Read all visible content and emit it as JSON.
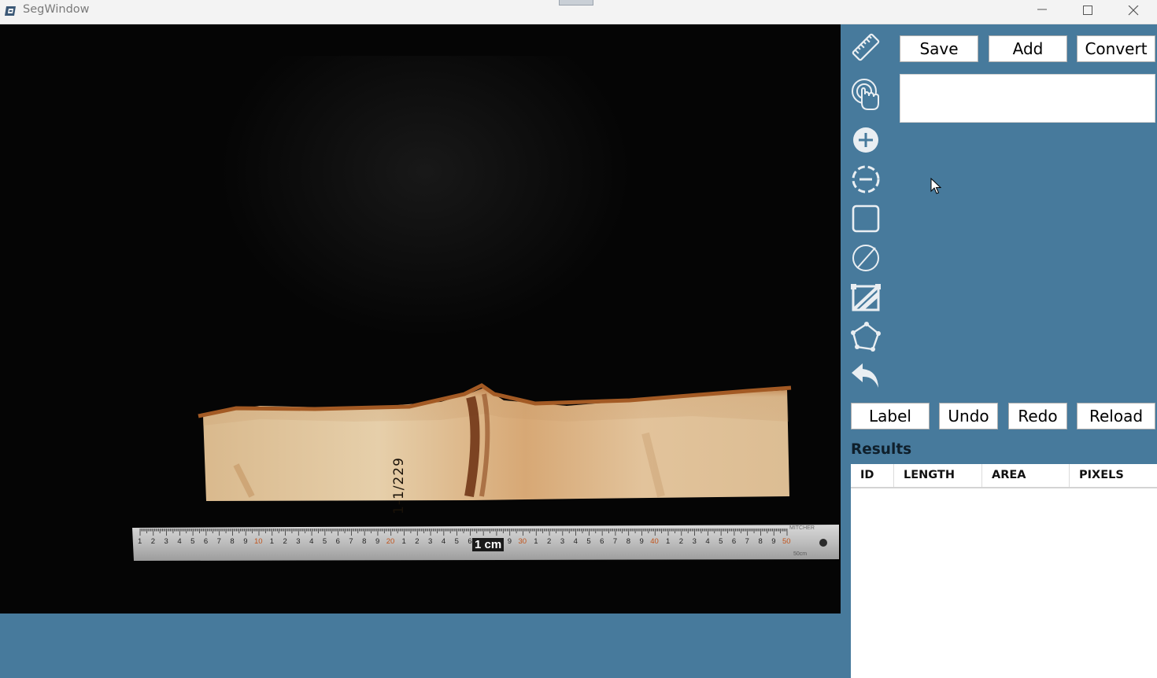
{
  "window": {
    "title": "SegWindow",
    "controls": {
      "minimize": "minimize",
      "maximize": "maximize",
      "close": "close"
    }
  },
  "canvas": {
    "specimen_label": "1-1/229",
    "ruler": {
      "scale_label": "1 cm",
      "brand": "MITCHER",
      "length_mark": "50cm",
      "numbers": [
        "1",
        "2",
        "3",
        "4",
        "5",
        "6",
        "7",
        "8",
        "9",
        "10",
        "1",
        "2",
        "3",
        "4",
        "5",
        "6",
        "7",
        "8",
        "9",
        "20",
        "1",
        "2",
        "3",
        "4",
        "5",
        "6",
        "7",
        "8",
        "9",
        "30",
        "1",
        "2",
        "3",
        "4",
        "5",
        "6",
        "7",
        "8",
        "9",
        "40",
        "1",
        "2",
        "3",
        "4",
        "5",
        "6",
        "7",
        "8",
        "9",
        "50"
      ]
    }
  },
  "tools": [
    {
      "name": "ruler-icon"
    },
    {
      "name": "touch-icon"
    },
    {
      "name": "add-circle-icon"
    },
    {
      "name": "dashed-circle-icon"
    },
    {
      "name": "rectangle-icon"
    },
    {
      "name": "no-mask-icon"
    },
    {
      "name": "crop-line-icon"
    },
    {
      "name": "polygon-icon"
    },
    {
      "name": "undo-arrow-icon"
    }
  ],
  "buttons": {
    "save": "Save",
    "add": "Add",
    "convert": "Convert",
    "label": "Label",
    "undo": "Undo",
    "redo": "Redo",
    "reload": "Reload"
  },
  "text_input": {
    "value": ""
  },
  "results": {
    "title": "Results",
    "columns": [
      "ID",
      "LENGTH",
      "AREA",
      "PIXELS"
    ],
    "rows": []
  },
  "colors": {
    "panel_bg": "#477a9c",
    "accent_icon": "#e9eef2",
    "title_bar": "#f3f3f3"
  }
}
